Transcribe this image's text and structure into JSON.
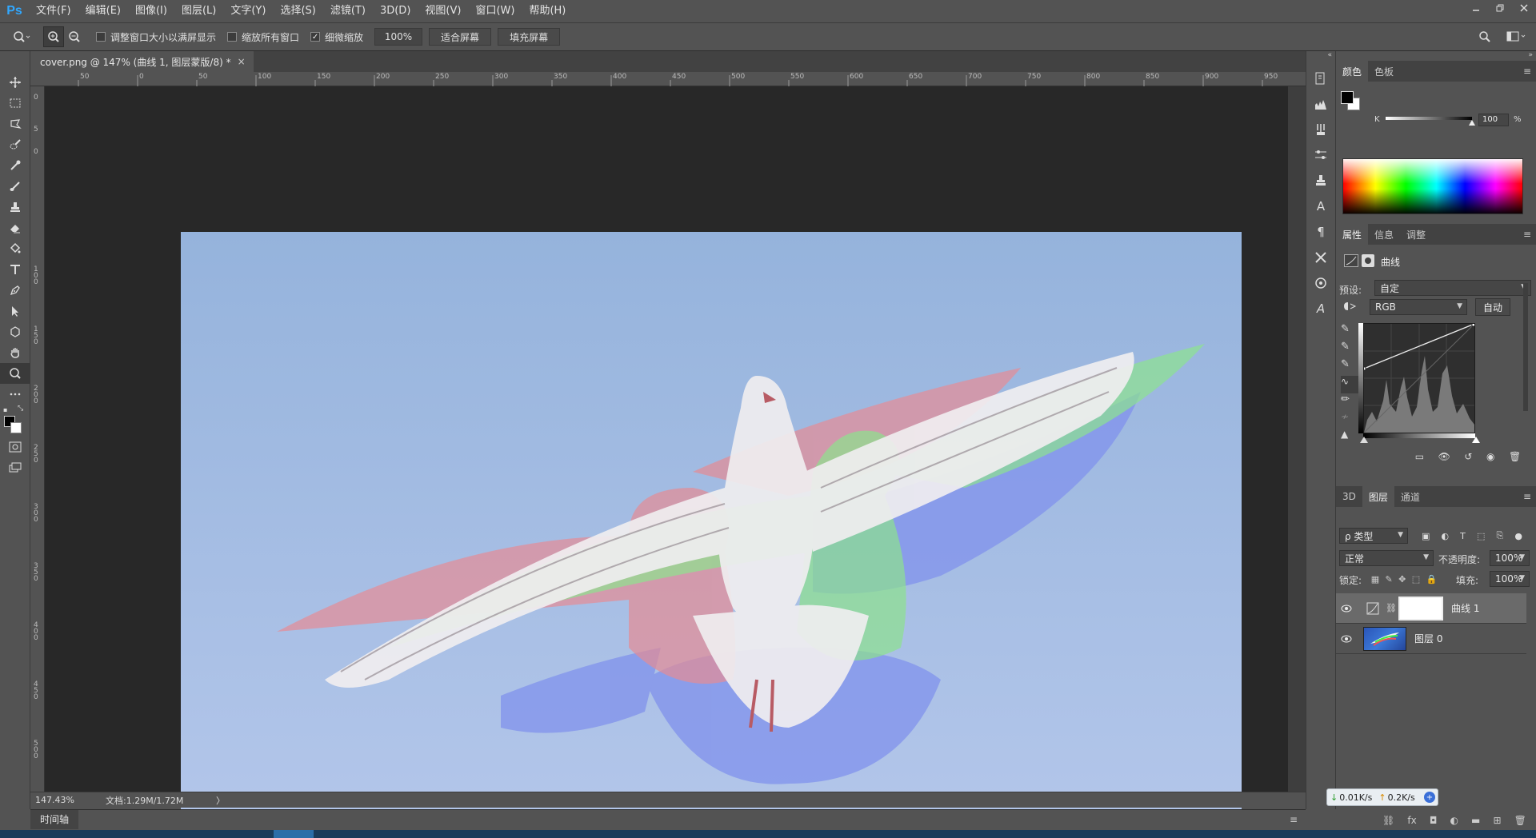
{
  "app": {
    "logo": "Ps"
  },
  "menu": [
    "文件(F)",
    "编辑(E)",
    "图像(I)",
    "图层(L)",
    "文字(Y)",
    "选择(S)",
    "滤镜(T)",
    "3D(D)",
    "视图(V)",
    "窗口(W)",
    "帮助(H)"
  ],
  "options": {
    "resize_windows": "调整窗口大小以满屏显示",
    "zoom_all": "缩放所有窗口",
    "scrubby_zoom": "细微缩放",
    "zoom_value": "100%",
    "fit_screen": "适合屏幕",
    "fill_screen": "填充屏幕"
  },
  "document": {
    "tab_title": "cover.png @ 147% (曲线 1, 图层蒙版/8) *",
    "tab_close": "×",
    "ruler_h": [
      "50",
      "0",
      "50",
      "100",
      "150",
      "200",
      "250",
      "300",
      "350",
      "400",
      "450",
      "500",
      "550",
      "600",
      "650",
      "700",
      "750",
      "800",
      "850",
      "900",
      "950"
    ],
    "ruler_v": [
      "0",
      "5",
      "0",
      "1\n0\n0",
      "1\n5\n0",
      "2\n0\n0",
      "2\n5\n0",
      "3\n0\n0",
      "3\n5\n0",
      "4\n0\n0",
      "4\n5\n0",
      "5\n0\n0"
    ],
    "zoom_status": "147.43%",
    "doc_status": "文档:1.29M/1.72M",
    "status_arrow": "〉",
    "timeline": "时间轴"
  },
  "color_panel": {
    "tabs": [
      "颜色",
      "色板"
    ],
    "channel": "K",
    "value": "100",
    "unit": "%"
  },
  "properties_panel": {
    "tabs": [
      "属性",
      "信息",
      "调整"
    ],
    "title": "曲线",
    "preset_label": "预设:",
    "preset_value": "自定",
    "channel": "RGB",
    "auto": "自动"
  },
  "layers_panel": {
    "tabs": [
      "3D",
      "图层",
      "通道"
    ],
    "filter": "ρ 类型",
    "blend_mode": "正常",
    "opacity_label": "不透明度:",
    "opacity": "100%",
    "lock_label": "锁定:",
    "fill_label": "填充:",
    "fill": "100%",
    "layers": [
      {
        "name": "曲线 1",
        "selected": true
      },
      {
        "name": "图层 0",
        "selected": false
      }
    ]
  },
  "network": {
    "down": "0.01K/s",
    "up": "0.2K/s"
  },
  "colors": {
    "accent": "#31a8ff",
    "annotation": "#e8141a",
    "canvas_bg": "#9ab7e0"
  }
}
